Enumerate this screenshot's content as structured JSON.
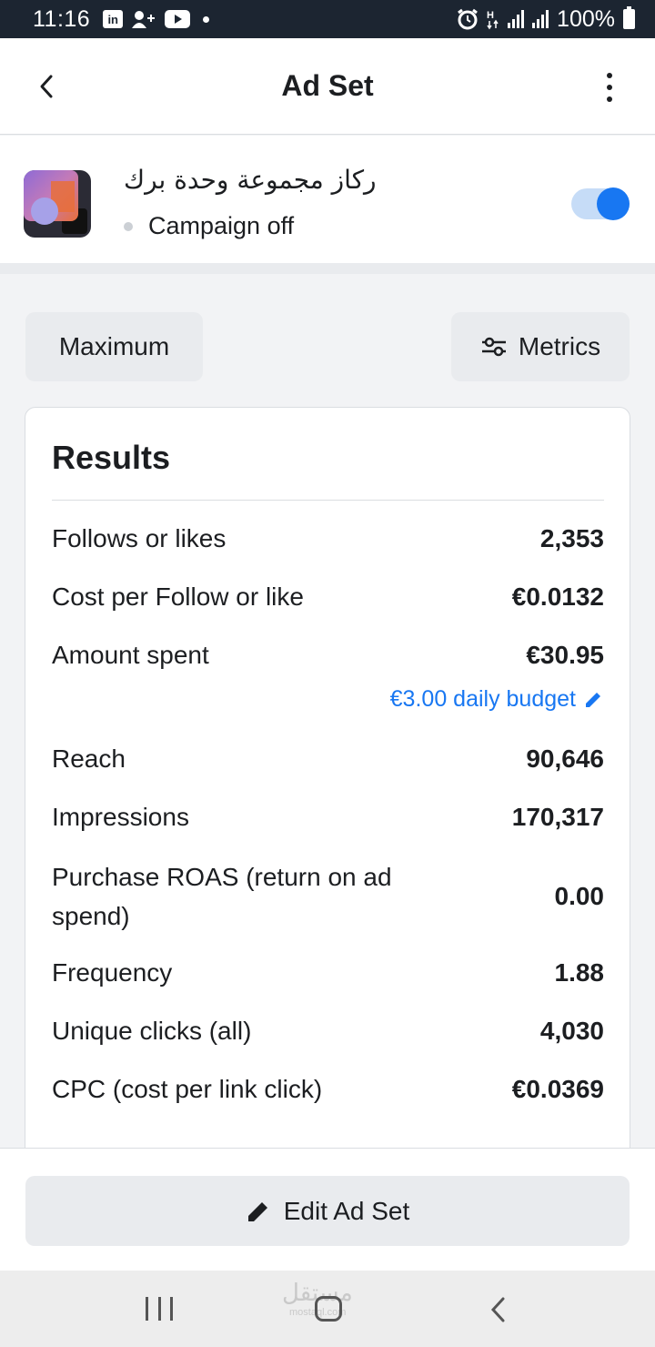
{
  "status_bar": {
    "time": "11:16",
    "battery": "100%",
    "icons": [
      "linkedin-icon",
      "add-person-icon",
      "youtube-icon",
      "alarm-icon",
      "data-icon",
      "signal-icon",
      "battery-icon"
    ]
  },
  "header": {
    "title": "Ad Set",
    "icons": [
      "back-chevron-icon",
      "more-vert-icon"
    ]
  },
  "ad_set": {
    "name": "ركاز مجموعة وحدة برك",
    "campaign_status": "Campaign off",
    "toggle_on": true
  },
  "controls": {
    "range_label": "Maximum",
    "metrics_label": "Metrics"
  },
  "results": {
    "title": "Results",
    "rows": [
      {
        "label": "Follows or likes",
        "value": "2,353"
      },
      {
        "label": "Cost per Follow or like",
        "value": "€0.0132"
      },
      {
        "label": "Amount spent",
        "value": "€30.95"
      },
      {
        "label": "Reach",
        "value": "90,646"
      },
      {
        "label": "Impressions",
        "value": "170,317"
      },
      {
        "label": "Purchase ROAS (return on ad spend)",
        "value": "0.00"
      },
      {
        "label": "Frequency",
        "value": "1.88"
      },
      {
        "label": "Unique clicks (all)",
        "value": "4,030"
      },
      {
        "label": "CPC (cost per link click)",
        "value": "€0.0369"
      }
    ],
    "budget_link": "€3.00 daily budget"
  },
  "actions": {
    "edit_label": "Edit Ad Set"
  },
  "watermark": {
    "text": "مستقل",
    "sub": "mostaql.com"
  },
  "colors": {
    "accent": "#1877f2",
    "status_bar": "#1c2531"
  }
}
